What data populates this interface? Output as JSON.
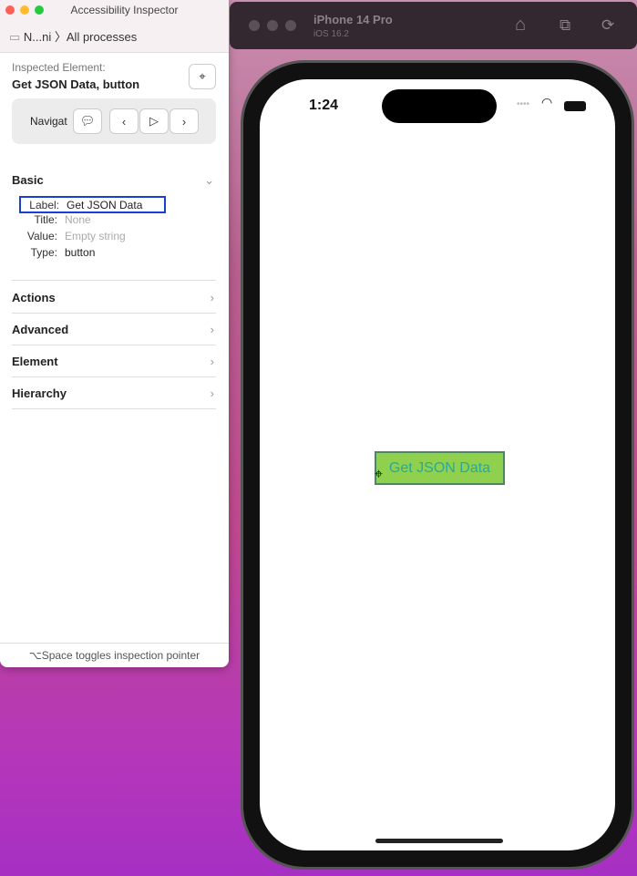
{
  "inspector": {
    "window_title": "Accessibility Inspector",
    "breadcrumb_device": "N...ni",
    "breadcrumb_target": "All processes",
    "inspected_label": "Inspected Element:",
    "inspected_value": "Get JSON Data, button",
    "navigate_label": "Navigat",
    "basic": {
      "title": "Basic",
      "rows": [
        {
          "key": "Label:",
          "value": "Get JSON Data"
        },
        {
          "key": "Title:",
          "value": "None"
        },
        {
          "key": "Value:",
          "value": "Empty string"
        },
        {
          "key": "Type:",
          "value": "button"
        }
      ]
    },
    "sections": [
      "Actions",
      "Advanced",
      "Element",
      "Hierarchy"
    ],
    "footer": "⌥Space toggles inspection pointer"
  },
  "simulator": {
    "device": "iPhone 14 Pro",
    "os": "iOS 16.2",
    "time": "1:24",
    "button_label": "Get JSON Data",
    "button_color": "#8fd14f",
    "button_text_color": "#2aa89a"
  }
}
